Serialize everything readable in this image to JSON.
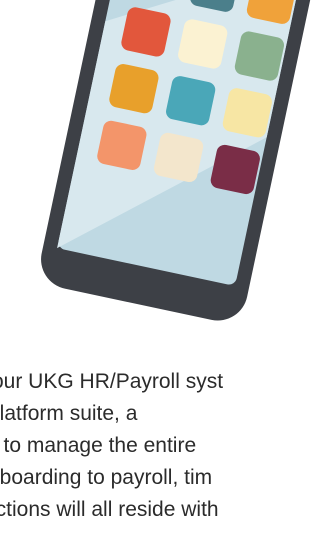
{
  "colors": {
    "phone_body": "#3d4046",
    "screen_bg": "#bfd9e3",
    "screen_highlight": "#d8e8ee",
    "text": "#2b2b2b"
  },
  "app_icons": [
    {
      "name": "app-icon-cream",
      "color": "#fbf3d4"
    },
    {
      "name": "app-icon-teal-dark",
      "color": "#4b7f8b"
    },
    {
      "name": "app-icon-orange",
      "color": "#f0a23a"
    },
    {
      "name": "app-icon-red",
      "color": "#e2573c"
    },
    {
      "name": "app-icon-cream-2",
      "color": "#fbf2d2"
    },
    {
      "name": "app-icon-sage",
      "color": "#8ab18e"
    },
    {
      "name": "app-icon-amber",
      "color": "#e8a02b"
    },
    {
      "name": "app-icon-teal",
      "color": "#4aa7b8"
    },
    {
      "name": "app-icon-yellow",
      "color": "#f7e6a4"
    },
    {
      "name": "app-icon-peach",
      "color": "#f3956a"
    },
    {
      "name": "app-icon-beige",
      "color": "#f3e6cc"
    },
    {
      "name": "app-icon-plum",
      "color": "#7a2d47"
    }
  ],
  "body_text": {
    "line1": "our UKG HR/Payroll syst",
    "line2": "platform suite, a",
    "line3": "d to manage the entire",
    "line4": "nboarding to payroll, tim",
    "line5": "nctions will all reside with"
  }
}
